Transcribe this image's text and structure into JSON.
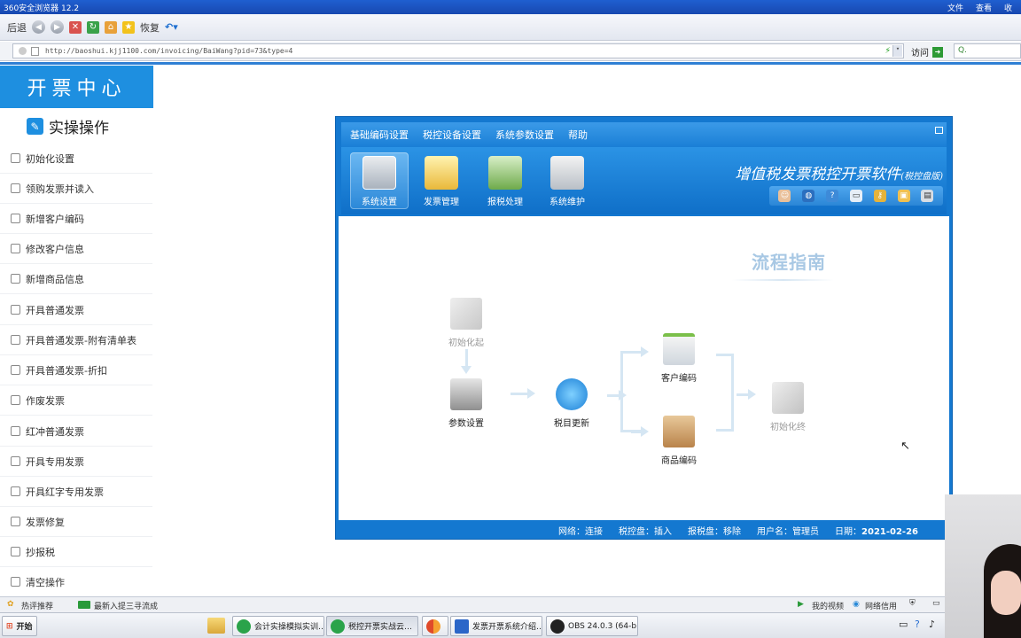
{
  "browser": {
    "title": "360安全浏览器 12.2",
    "title_menu": [
      "文件",
      "查看",
      "收"
    ],
    "back_label": "后退",
    "restore_label": "恢复",
    "address": "http://baoshui.kjj1100.com/invoicing/BaiWang?pid=73&type=4",
    "go_label": "访问",
    "search_placeholder": "Q."
  },
  "sidebar": {
    "title": "开票中心",
    "section": "实操操作",
    "items": [
      "初始化设置",
      "领购发票并读入",
      "新增客户编码",
      "修改客户信息",
      "新增商品信息",
      "开具普通发票",
      "开具普通发票-附有清单表",
      "开具普通发票-折扣",
      "作废发票",
      "红冲普通发票",
      "开具专用发票",
      "开具红字专用发票",
      "发票修复",
      "抄报税",
      "清空操作"
    ]
  },
  "app": {
    "menu": [
      "基础编码设置",
      "税控设备设置",
      "系统参数设置",
      "帮助"
    ],
    "ribbon": [
      "系统设置",
      "发票管理",
      "报税处理",
      "系统维护"
    ],
    "brand": "增值税发票税控开票软件",
    "brand_sub": "(税控盘版)",
    "flow_title": "流程指南",
    "flow": {
      "init_start": "初始化起",
      "param": "参数设置",
      "tax_update": "税目更新",
      "customer": "客户编码",
      "goods": "商品编码",
      "init_end": "初始化终"
    },
    "status": {
      "network": "网络：连接",
      "tax_disk": "税控盘：插入",
      "report_disk": "报税盘：移除",
      "user": "用户名：管理员",
      "date_label": "日期：",
      "date": "2021-02-26"
    }
  },
  "ie_status": {
    "left1": "热评推荐",
    "left2": "最新入提三寻流成",
    "right": [
      "我的视频",
      "网络信用"
    ]
  },
  "taskbar": {
    "start": "开始",
    "tasks": [
      "会计实操模拟实训…",
      "税控开票实战云…",
      "",
      "发票开票系统介绍…",
      "OBS 24.0.3 (64-b…"
    ]
  },
  "colors": {
    "accent": "#1e8fe0",
    "app_blue": "#1478d0"
  }
}
